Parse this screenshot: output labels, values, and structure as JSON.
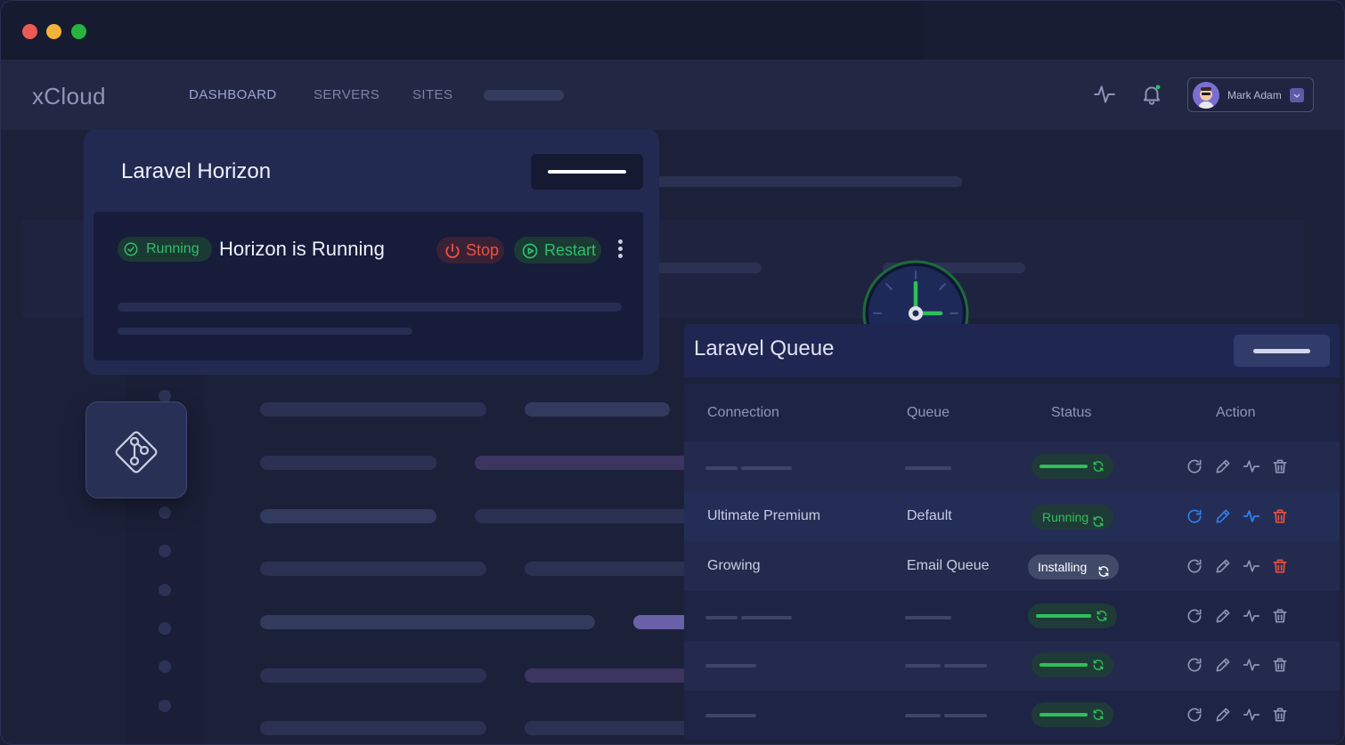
{
  "app": {
    "brand": "xCloud"
  },
  "nav": {
    "items": [
      {
        "label": "DASHBOARD",
        "active": true
      },
      {
        "label": "SERVERS",
        "active": false
      },
      {
        "label": "SITES",
        "active": false
      }
    ],
    "icons": [
      "activity-icon",
      "bell-icon"
    ],
    "user": {
      "name": "Mark Adam"
    }
  },
  "horizon": {
    "title": "Laravel Horizon",
    "badge": "Running",
    "status_text": "Horizon is Running",
    "stop_label": "Stop",
    "restart_label": "Restart"
  },
  "queue": {
    "title": "Laravel Queue",
    "columns": [
      "Connection",
      "Queue",
      "Status",
      "Action"
    ],
    "rows": [
      {
        "connection": "",
        "queue": "",
        "status": ""
      },
      {
        "connection": "Ultimate Premium",
        "queue": "Default",
        "status": "Running"
      },
      {
        "connection": "Growing",
        "queue": "Email Queue",
        "status": "Installing"
      },
      {
        "connection": "",
        "queue": "",
        "status": ""
      },
      {
        "connection": "",
        "queue": "",
        "status": ""
      },
      {
        "connection": "",
        "queue": "",
        "status": ""
      }
    ]
  },
  "colors": {
    "accent": "#9aa3d6",
    "success": "#2fbf6a",
    "danger": "#e8533f",
    "info": "#2f7ff0"
  }
}
